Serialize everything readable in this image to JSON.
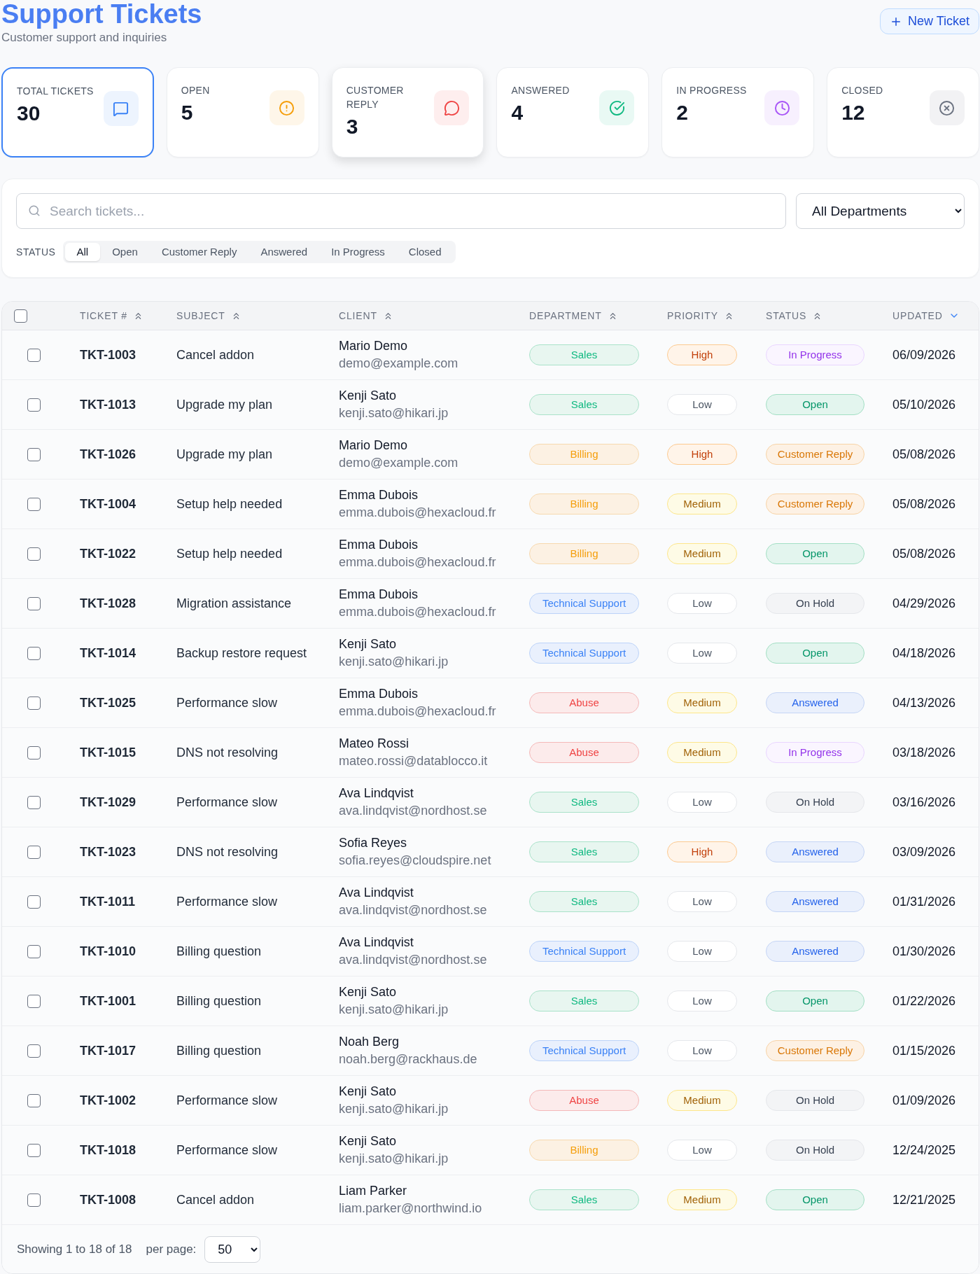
{
  "header": {
    "title": "Support Tickets",
    "subtitle": "Customer support and inquiries",
    "new_button": "New Ticket"
  },
  "stats": [
    {
      "label": "TOTAL TICKETS",
      "value": "30",
      "color": "#3b82f6",
      "selected": true,
      "hovered": false
    },
    {
      "label": "OPEN",
      "value": "5",
      "color": "#f59e0b",
      "selected": false,
      "hovered": false
    },
    {
      "label": "CUSTOMER REPLY",
      "value": "3",
      "color": "#ef4444",
      "selected": false,
      "hovered": true
    },
    {
      "label": "ANSWERED",
      "value": "4",
      "color": "#10b981",
      "selected": false,
      "hovered": false
    },
    {
      "label": "IN PROGRESS",
      "value": "2",
      "color": "#a855f7",
      "selected": false,
      "hovered": false
    },
    {
      "label": "CLOSED",
      "value": "12",
      "color": "#6b7280",
      "selected": false,
      "hovered": false
    }
  ],
  "search": {
    "placeholder": "Search tickets..."
  },
  "department_filter": {
    "value": "All Departments"
  },
  "status_filter": {
    "label": "STATUS",
    "options": [
      {
        "label": "All",
        "selected": true
      },
      {
        "label": "Open",
        "selected": false
      },
      {
        "label": "Customer Reply",
        "selected": false
      },
      {
        "label": "Answered",
        "selected": false
      },
      {
        "label": "In Progress",
        "selected": false
      },
      {
        "label": "Closed",
        "selected": false
      }
    ]
  },
  "table": {
    "select_all": {
      "checked": false
    },
    "columns": [
      {
        "label": "TICKET #",
        "sorted": false
      },
      {
        "label": "SUBJECT",
        "sorted": false
      },
      {
        "label": "CLIENT",
        "sorted": false
      },
      {
        "label": "DEPARTMENT",
        "sorted": false
      },
      {
        "label": "PRIORITY",
        "sorted": false
      },
      {
        "label": "STATUS",
        "sorted": false
      },
      {
        "label": "UPDATED",
        "sorted": true
      }
    ],
    "rows": [
      {
        "checked": false,
        "ticket": "TKT-1003",
        "subject": "Cancel addon",
        "client": {
          "name": "Mario Demo",
          "email": "demo@example.com"
        },
        "department": {
          "label": "Sales",
          "color": "#10b981"
        },
        "priority": {
          "label": "High",
          "color": "#c2410c"
        },
        "status": {
          "label": "In Progress",
          "color": "#9333ea"
        },
        "updated": "06/09/2026"
      },
      {
        "checked": false,
        "ticket": "TKT-1013",
        "subject": "Upgrade my plan",
        "client": {
          "name": "Kenji Sato",
          "email": "kenji.sato@hikari.jp"
        },
        "department": {
          "label": "Sales",
          "color": "#10b981"
        },
        "priority": {
          "label": "Low",
          "color": "#4b5563"
        },
        "status": {
          "label": "Open",
          "color": "#059669"
        },
        "updated": "05/10/2026"
      },
      {
        "checked": false,
        "ticket": "TKT-1026",
        "subject": "Upgrade my plan",
        "client": {
          "name": "Mario Demo",
          "email": "demo@example.com"
        },
        "department": {
          "label": "Billing",
          "color": "#f59e0b"
        },
        "priority": {
          "label": "High",
          "color": "#c2410c"
        },
        "status": {
          "label": "Customer Reply",
          "color": "#d97706"
        },
        "updated": "05/08/2026"
      },
      {
        "checked": false,
        "ticket": "TKT-1004",
        "subject": "Setup help needed",
        "client": {
          "name": "Emma Dubois",
          "email": "emma.dubois@hexacloud.fr"
        },
        "department": {
          "label": "Billing",
          "color": "#f59e0b"
        },
        "priority": {
          "label": "Medium",
          "color": "#a16207"
        },
        "status": {
          "label": "Customer Reply",
          "color": "#d97706"
        },
        "updated": "05/08/2026"
      },
      {
        "checked": false,
        "ticket": "TKT-1022",
        "subject": "Setup help needed",
        "client": {
          "name": "Emma Dubois",
          "email": "emma.dubois@hexacloud.fr"
        },
        "department": {
          "label": "Billing",
          "color": "#f59e0b"
        },
        "priority": {
          "label": "Medium",
          "color": "#a16207"
        },
        "status": {
          "label": "Open",
          "color": "#059669"
        },
        "updated": "05/08/2026"
      },
      {
        "checked": false,
        "ticket": "TKT-1028",
        "subject": "Migration assistance",
        "client": {
          "name": "Emma Dubois",
          "email": "emma.dubois@hexacloud.fr"
        },
        "department": {
          "label": "Technical Support",
          "color": "#3b82f6"
        },
        "priority": {
          "label": "Low",
          "color": "#4b5563"
        },
        "status": {
          "label": "On Hold",
          "color": "#374151"
        },
        "updated": "04/29/2026"
      },
      {
        "checked": false,
        "ticket": "TKT-1014",
        "subject": "Backup restore request",
        "client": {
          "name": "Kenji Sato",
          "email": "kenji.sato@hikari.jp"
        },
        "department": {
          "label": "Technical Support",
          "color": "#3b82f6"
        },
        "priority": {
          "label": "Low",
          "color": "#4b5563"
        },
        "status": {
          "label": "Open",
          "color": "#059669"
        },
        "updated": "04/18/2026"
      },
      {
        "checked": false,
        "ticket": "TKT-1025",
        "subject": "Performance slow",
        "client": {
          "name": "Emma Dubois",
          "email": "emma.dubois@hexacloud.fr"
        },
        "department": {
          "label": "Abuse",
          "color": "#ef4444"
        },
        "priority": {
          "label": "Medium",
          "color": "#a16207"
        },
        "status": {
          "label": "Answered",
          "color": "#2563eb"
        },
        "updated": "04/13/2026"
      },
      {
        "checked": false,
        "ticket": "TKT-1015",
        "subject": "DNS not resolving",
        "client": {
          "name": "Mateo Rossi",
          "email": "mateo.rossi@datablocco.it"
        },
        "department": {
          "label": "Abuse",
          "color": "#ef4444"
        },
        "priority": {
          "label": "Medium",
          "color": "#a16207"
        },
        "status": {
          "label": "In Progress",
          "color": "#9333ea"
        },
        "updated": "03/18/2026"
      },
      {
        "checked": false,
        "ticket": "TKT-1029",
        "subject": "Performance slow",
        "client": {
          "name": "Ava Lindqvist",
          "email": "ava.lindqvist@nordhost.se"
        },
        "department": {
          "label": "Sales",
          "color": "#10b981"
        },
        "priority": {
          "label": "Low",
          "color": "#4b5563"
        },
        "status": {
          "label": "On Hold",
          "color": "#374151"
        },
        "updated": "03/16/2026"
      },
      {
        "checked": false,
        "ticket": "TKT-1023",
        "subject": "DNS not resolving",
        "client": {
          "name": "Sofia Reyes",
          "email": "sofia.reyes@cloudspire.net"
        },
        "department": {
          "label": "Sales",
          "color": "#10b981"
        },
        "priority": {
          "label": "High",
          "color": "#c2410c"
        },
        "status": {
          "label": "Answered",
          "color": "#2563eb"
        },
        "updated": "03/09/2026"
      },
      {
        "checked": false,
        "ticket": "TKT-1011",
        "subject": "Performance slow",
        "client": {
          "name": "Ava Lindqvist",
          "email": "ava.lindqvist@nordhost.se"
        },
        "department": {
          "label": "Sales",
          "color": "#10b981"
        },
        "priority": {
          "label": "Low",
          "color": "#4b5563"
        },
        "status": {
          "label": "Answered",
          "color": "#2563eb"
        },
        "updated": "01/31/2026"
      },
      {
        "checked": false,
        "ticket": "TKT-1010",
        "subject": "Billing question",
        "client": {
          "name": "Ava Lindqvist",
          "email": "ava.lindqvist@nordhost.se"
        },
        "department": {
          "label": "Technical Support",
          "color": "#3b82f6"
        },
        "priority": {
          "label": "Low",
          "color": "#4b5563"
        },
        "status": {
          "label": "Answered",
          "color": "#2563eb"
        },
        "updated": "01/30/2026"
      },
      {
        "checked": false,
        "ticket": "TKT-1001",
        "subject": "Billing question",
        "client": {
          "name": "Kenji Sato",
          "email": "kenji.sato@hikari.jp"
        },
        "department": {
          "label": "Sales",
          "color": "#10b981"
        },
        "priority": {
          "label": "Low",
          "color": "#4b5563"
        },
        "status": {
          "label": "Open",
          "color": "#059669"
        },
        "updated": "01/22/2026"
      },
      {
        "checked": false,
        "ticket": "TKT-1017",
        "subject": "Billing question",
        "client": {
          "name": "Noah Berg",
          "email": "noah.berg@rackhaus.de"
        },
        "department": {
          "label": "Technical Support",
          "color": "#3b82f6"
        },
        "priority": {
          "label": "Low",
          "color": "#4b5563"
        },
        "status": {
          "label": "Customer Reply",
          "color": "#d97706"
        },
        "updated": "01/15/2026"
      },
      {
        "checked": false,
        "ticket": "TKT-1002",
        "subject": "Performance slow",
        "client": {
          "name": "Kenji Sato",
          "email": "kenji.sato@hikari.jp"
        },
        "department": {
          "label": "Abuse",
          "color": "#ef4444"
        },
        "priority": {
          "label": "Medium",
          "color": "#a16207"
        },
        "status": {
          "label": "On Hold",
          "color": "#374151"
        },
        "updated": "01/09/2026"
      },
      {
        "checked": false,
        "ticket": "TKT-1018",
        "subject": "Performance slow",
        "client": {
          "name": "Kenji Sato",
          "email": "kenji.sato@hikari.jp"
        },
        "department": {
          "label": "Billing",
          "color": "#f59e0b"
        },
        "priority": {
          "label": "Low",
          "color": "#4b5563"
        },
        "status": {
          "label": "On Hold",
          "color": "#374151"
        },
        "updated": "12/24/2025"
      },
      {
        "checked": false,
        "ticket": "TKT-1008",
        "subject": "Cancel addon",
        "client": {
          "name": "Liam Parker",
          "email": "liam.parker@northwind.io"
        },
        "department": {
          "label": "Sales",
          "color": "#10b981"
        },
        "priority": {
          "label": "Medium",
          "color": "#a16207"
        },
        "status": {
          "label": "Open",
          "color": "#059669"
        },
        "updated": "12/21/2025"
      }
    ]
  },
  "pagination": {
    "summary": "Showing 1 to 18 of 18",
    "per_page_label": "per page:",
    "per_page": "50"
  }
}
